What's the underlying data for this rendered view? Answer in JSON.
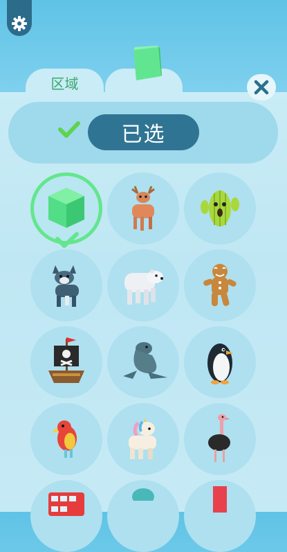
{
  "top": {
    "settings_icon": "gear-icon",
    "tabs": [
      {
        "label": "区域",
        "active": false
      },
      {
        "icon": "cube-icon",
        "active": true
      }
    ],
    "close_icon": "close-icon"
  },
  "header": {
    "status_icon": "check-icon",
    "status_label": "已选"
  },
  "grid": {
    "items": [
      {
        "name": "cube",
        "icon": "cube-icon",
        "selected": true
      },
      {
        "name": "deer",
        "icon": "deer-icon",
        "selected": false
      },
      {
        "name": "cactus",
        "icon": "cactus-icon",
        "selected": false
      },
      {
        "name": "wolf",
        "icon": "wolf-icon",
        "selected": false
      },
      {
        "name": "polar-bear",
        "icon": "polar-bear-icon",
        "selected": false
      },
      {
        "name": "gingerbread-man",
        "icon": "gingerbread-icon",
        "selected": false
      },
      {
        "name": "pirate-ship",
        "icon": "pirate-ship-icon",
        "selected": false
      },
      {
        "name": "seal",
        "icon": "seal-icon",
        "selected": false
      },
      {
        "name": "penguin",
        "icon": "penguin-icon",
        "selected": false
      },
      {
        "name": "parrot",
        "icon": "parrot-icon",
        "selected": false
      },
      {
        "name": "unicorn",
        "icon": "unicorn-icon",
        "selected": false
      },
      {
        "name": "ostrich",
        "icon": "ostrich-icon",
        "selected": false
      },
      {
        "name": "bus",
        "icon": "bus-icon",
        "selected": false
      },
      {
        "name": "ball",
        "icon": "ball-icon",
        "selected": false
      },
      {
        "name": "red-block",
        "icon": "block-icon",
        "selected": false
      }
    ]
  },
  "colors": {
    "accent_green": "#63e68d",
    "pill_blue": "#2f7593",
    "panel": "#c9ecf6",
    "slot": "#aee0ef"
  }
}
